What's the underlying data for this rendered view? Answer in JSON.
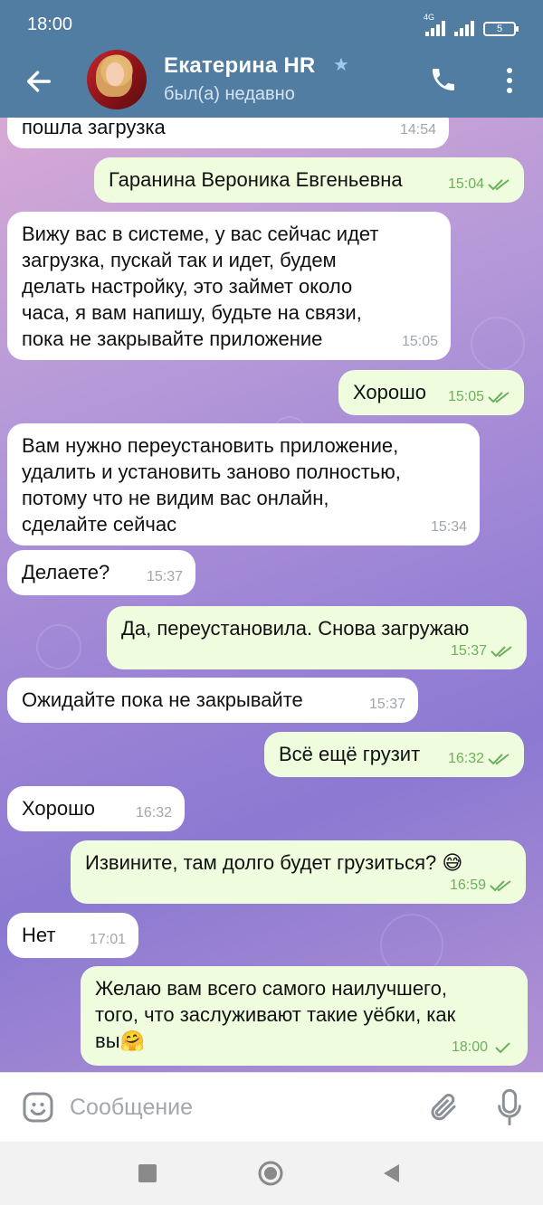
{
  "statusbar": {
    "time": "18:00",
    "network": "4G",
    "battery": "5"
  },
  "header": {
    "name": "Екатерина HR",
    "status": "был(а) недавно"
  },
  "messages": [
    {
      "dir": "in",
      "lines": [
        "пошла загрузка"
      ],
      "time": "14:54"
    },
    {
      "dir": "out",
      "lines": [
        "Гаранина Вероника Евгеньевна"
      ],
      "time": "15:04"
    },
    {
      "dir": "in",
      "lines": [
        "Вижу вас в системе, у вас сейчас идет",
        "загрузка, пускай так и идет, будем",
        "делать настройку, это займет около",
        "часа, я вам напишу, будьте на связи,",
        "пока не закрывайте приложение"
      ],
      "time": "15:05"
    },
    {
      "dir": "out",
      "lines": [
        "Хорошо"
      ],
      "time": "15:05"
    },
    {
      "dir": "in",
      "lines": [
        "Вам нужно переустановить приложение,",
        "удалить и установить заново полностью,",
        "потому что не видим вас онлайн,",
        "сделайте сейчас"
      ],
      "time": "15:34"
    },
    {
      "dir": "in",
      "lines": [
        "Делаете?"
      ],
      "time": "15:37"
    },
    {
      "dir": "out",
      "lines": [
        "Да, переустановила. Снова загружаю"
      ],
      "time": "15:37"
    },
    {
      "dir": "in",
      "lines": [
        "Ожидайте пока не закрывайте"
      ],
      "time": "15:37"
    },
    {
      "dir": "out",
      "lines": [
        "Всё ещё грузит"
      ],
      "time": "16:32"
    },
    {
      "dir": "in",
      "lines": [
        "Хорошо"
      ],
      "time": "16:32"
    },
    {
      "dir": "out",
      "lines": [
        "Извините, там долго будет грузиться? 😅"
      ],
      "time": "16:59"
    },
    {
      "dir": "in",
      "lines": [
        "Нет"
      ],
      "time": "17:01"
    },
    {
      "dir": "out",
      "lines": [
        "Желаю вам всего самого наилучшего,",
        "того, что заслуживают такие уёбки, как",
        "вы🤗"
      ],
      "time": "18:00"
    }
  ],
  "input": {
    "placeholder": "Сообщение"
  },
  "colors": {
    "header": "#517da2",
    "incoming": "#ffffff",
    "outgoing": "#effdde",
    "check": "#6cb05d"
  }
}
